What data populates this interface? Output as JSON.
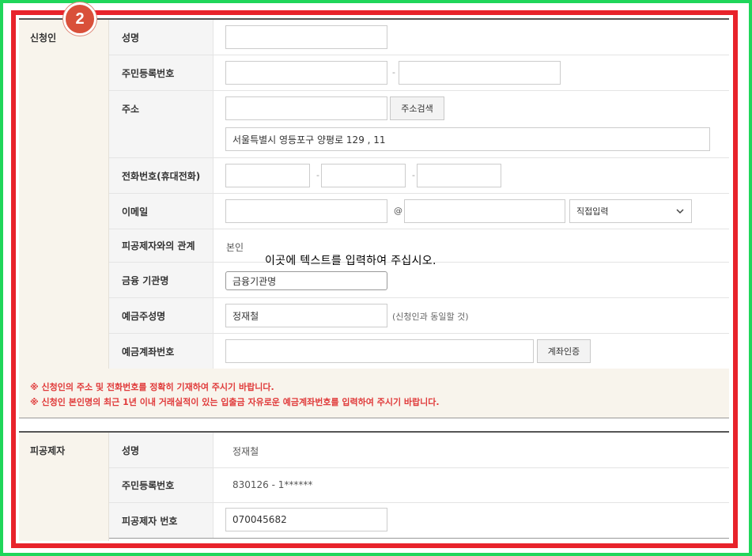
{
  "badge": "2",
  "applicant": {
    "section_label": "신청인",
    "name_label": "성명",
    "rrn_label": "주민등록번호",
    "address_label": "주소",
    "address_search_button": "주소검색",
    "address_detail_value": "서울특별시 영등포구 양평로 129 , 11",
    "phone_label": "전화번호(휴대전화)",
    "email_label": "이메일",
    "email_at": "@",
    "email_domain_select": "직접입력",
    "relation_label": "피공제자와의 관계",
    "relation_value": "본인",
    "bank_label": "금융 기관명",
    "bank_value": "금융기관명",
    "depositor_label": "예금주성명",
    "depositor_value": "정재철",
    "depositor_note": "(신청인과 동일할 것)",
    "account_label": "예금계좌번호",
    "account_verify_button": "계좌인증",
    "dash": "-"
  },
  "notices": [
    "※ 신청인의 주소 및 전화번호를 정확히 기재하여 주시기 바랍니다.",
    "※ 신청인 본인명의 최근 1년 이내 거래실적이 있는 입출금 자유로운 예금계좌번호를 입력하여 주시기 바랍니다."
  ],
  "insured": {
    "section_label": "피공제자",
    "name_label": "성명",
    "name_value": "정재철",
    "rrn_label": "주민등록번호",
    "rrn_value": "830126 - 1******",
    "number_label": "피공제자 번호",
    "number_value": "070045682"
  },
  "overlay_text": "이곳에 텍스트를 입력하여 주십시오.",
  "colors": {
    "outer_frame": "#1fd65a",
    "highlight_frame": "#e8232b",
    "badge": "#d9503a",
    "notice_text": "#e03a3a"
  }
}
